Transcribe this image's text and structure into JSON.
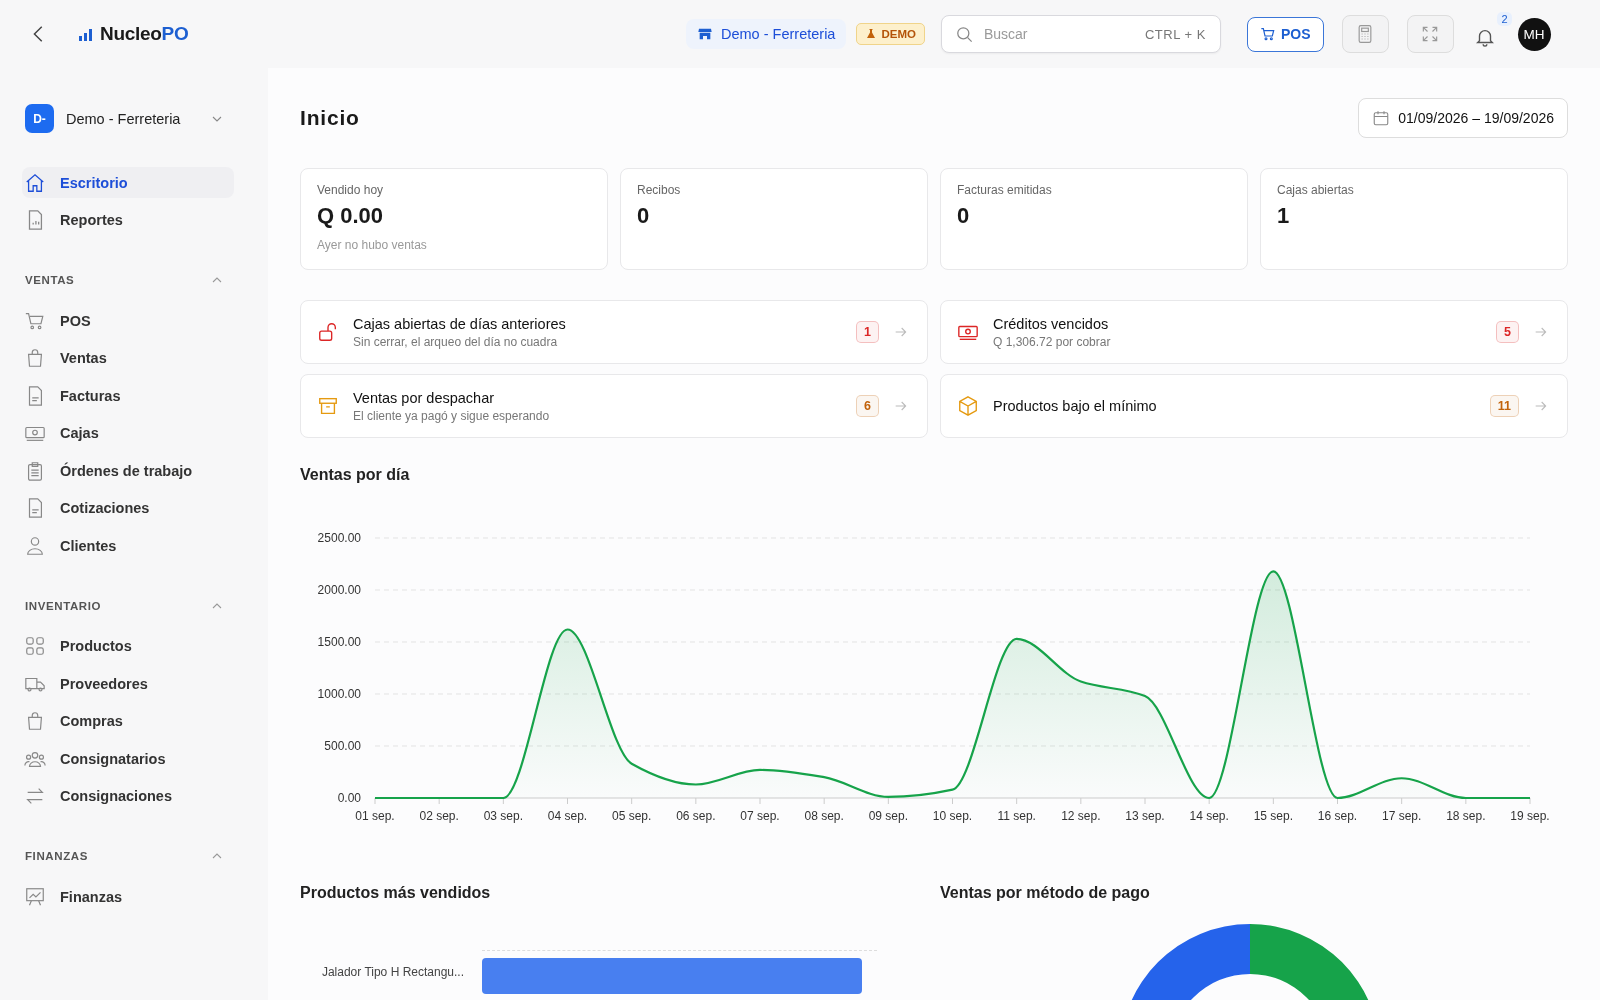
{
  "topbar": {
    "logo": {
      "text": "Nucleo",
      "accent": "PO"
    },
    "store": "Demo - Ferreteria",
    "env_badge": "DEMO",
    "search": {
      "placeholder": "Buscar",
      "shortcut": "CTRL + K"
    },
    "pos_button": "POS",
    "notifications": "2",
    "avatar": "MH"
  },
  "sidebar": {
    "company": {
      "initials": "D-",
      "name": "Demo - Ferreteria"
    },
    "top_items": [
      {
        "label": "Escritorio",
        "selected": true
      },
      {
        "label": "Reportes",
        "selected": false
      }
    ],
    "sections": [
      {
        "title": "VENTAS",
        "expanded": true,
        "items": [
          {
            "label": "POS",
            "selected": false
          },
          {
            "label": "Ventas",
            "selected": false
          },
          {
            "label": "Facturas",
            "selected": false
          },
          {
            "label": "Cajas",
            "selected": false
          },
          {
            "label": "Órdenes de trabajo",
            "selected": false
          },
          {
            "label": "Cotizaciones",
            "selected": false
          },
          {
            "label": "Clientes",
            "selected": false
          }
        ]
      },
      {
        "title": "INVENTARIO",
        "expanded": true,
        "items": [
          {
            "label": "Productos",
            "selected": false
          },
          {
            "label": "Proveedores",
            "selected": false
          },
          {
            "label": "Compras",
            "selected": false
          },
          {
            "label": "Consignatarios",
            "selected": false
          },
          {
            "label": "Consignaciones",
            "selected": false
          }
        ]
      },
      {
        "title": "FINANZAS",
        "expanded": true,
        "items": [
          {
            "label": "Finanzas",
            "selected": false
          }
        ]
      }
    ]
  },
  "page": {
    "title": "Inicio",
    "date_range": "01/09/2026 – 19/09/2026"
  },
  "stats": [
    {
      "label": "Vendido hoy",
      "value": "Q 0.00",
      "note": "Ayer no hubo ventas"
    },
    {
      "label": "Recibos",
      "value": "0"
    },
    {
      "label": "Facturas emitidas",
      "value": "0"
    },
    {
      "label": "Cajas abiertas",
      "value": "1"
    }
  ],
  "alerts": [
    {
      "title": "Cajas abiertas de días anteriores",
      "subtitle": "Sin cerrar, el arqueo del día no cuadra",
      "count": "1",
      "color": "#dc2626"
    },
    {
      "title": "Créditos vencidos",
      "subtitle": "Q 1,306.72 por cobrar",
      "count": "5",
      "color": "#dc2626"
    },
    {
      "title": "Ventas por despachar",
      "subtitle": "El cliente ya pagó y sigue esperando",
      "count": "6",
      "color": "#c2620a"
    },
    {
      "title": "Productos bajo el mínimo",
      "count": "11",
      "color": "#c2620a"
    }
  ],
  "sales_chart": {
    "title": "Ventas por día",
    "chart_data": {
      "type": "area",
      "categories": [
        "01 sep.",
        "02 sep.",
        "03 sep.",
        "04 sep.",
        "05 sep.",
        "06 sep.",
        "07 sep.",
        "08 sep.",
        "09 sep.",
        "10 sep.",
        "11 sep.",
        "12 sep.",
        "13 sep.",
        "14 sep.",
        "15 sep.",
        "16 sep.",
        "17 sep.",
        "18 sep.",
        "19 sep."
      ],
      "grid": true,
      "series": [
        {
          "color": "#16a34a",
          "values": [
            0,
            0,
            0,
            1620,
            330,
            130,
            270,
            200,
            10,
            80,
            1530,
            1120,
            980,
            0,
            2180,
            0,
            190,
            0,
            0
          ]
        }
      ],
      "ylim": [
        0,
        2500
      ],
      "yticks": [
        {
          "value": 0,
          "label": "0.00"
        },
        {
          "value": 500,
          "label": "500.00"
        },
        {
          "value": 1000,
          "label": "1000.00"
        },
        {
          "value": 1500,
          "label": "1500.00"
        },
        {
          "value": 2000,
          "label": "2000.00"
        },
        {
          "value": 2500,
          "label": "2500.00"
        }
      ]
    }
  },
  "top_products": {
    "title": "Productos más vendidos",
    "product": "Jalador Tipo H Rectangu..."
  },
  "payment_methods": {
    "title": "Ventas por método de pago"
  }
}
